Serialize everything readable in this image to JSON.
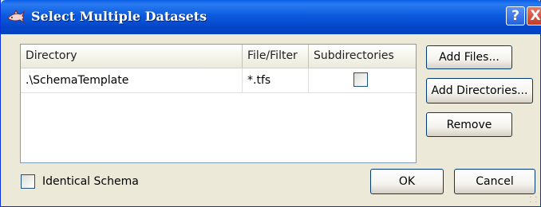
{
  "window": {
    "title": "Select Multiple Datasets",
    "help_label": "?",
    "close_label": "X"
  },
  "grid": {
    "columns": [
      "Directory",
      "File/Filter",
      "Subdirectories"
    ],
    "rows": [
      {
        "directory": ".\\SchemaTemplate",
        "filter": "*.tfs",
        "subdirectories": false
      }
    ]
  },
  "buttons": {
    "add_files": "Add Files...",
    "add_directories": "Add Directories...",
    "remove": "Remove",
    "ok": "OK",
    "cancel": "Cancel"
  },
  "options": {
    "identical_schema_label": "Identical Schema",
    "identical_schema_checked": false
  },
  "colors": {
    "titlebar": "#0b5bdf",
    "dialog_background": "#ece9d8",
    "grid_border": "#7f9db9"
  },
  "icons": {
    "app": "shark-icon",
    "help": "help-icon",
    "close": "close-icon"
  }
}
